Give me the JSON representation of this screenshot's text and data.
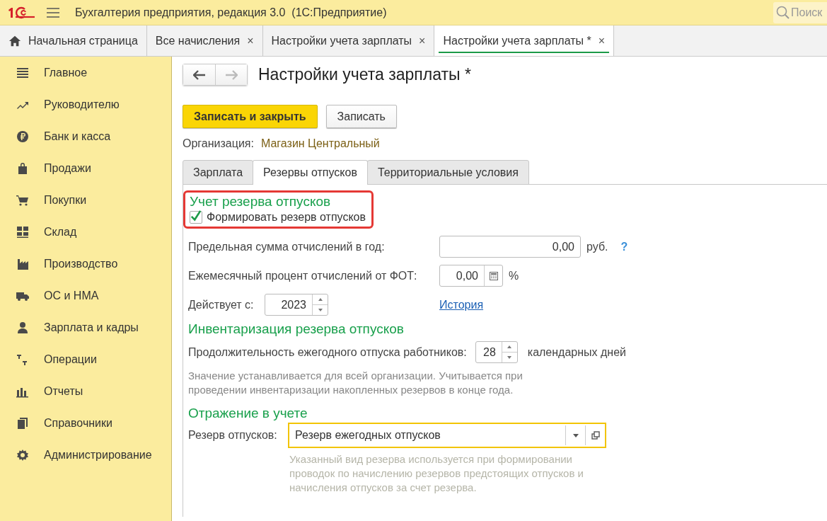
{
  "app_bar": {
    "title": "Бухгалтерия предприятия, редакция 3.0  (1С:Предприятие)",
    "search": {
      "placeholder": "Поиск"
    }
  },
  "open_tabs": [
    {
      "label": "Начальная страница",
      "selected": false,
      "kind": "home"
    },
    {
      "label": "Все начисления",
      "selected": false,
      "kind": "closable",
      "close": "×"
    },
    {
      "label": "Настройки учета зарплаты",
      "selected": false,
      "kind": "closable",
      "close": "×"
    },
    {
      "label": "Настройки учета зарплаты *",
      "selected": true,
      "kind": "closable",
      "close": "×"
    }
  ],
  "sidebar": {
    "items": [
      {
        "label": "Главное"
      },
      {
        "label": "Руководителю"
      },
      {
        "label": "Банк и касса"
      },
      {
        "label": "Продажи"
      },
      {
        "label": "Покупки"
      },
      {
        "label": "Склад"
      },
      {
        "label": "Производство"
      },
      {
        "label": "ОС и НМА"
      },
      {
        "label": "Зарплата и кадры"
      },
      {
        "label": "Операции"
      },
      {
        "label": "Отчеты"
      },
      {
        "label": "Справочники"
      },
      {
        "label": "Администрирование"
      }
    ]
  },
  "form": {
    "title": "Настройки учета зарплаты *",
    "buttons": [
      {
        "label": "Записать и закрыть",
        "kind": "primary"
      },
      {
        "label": "Записать",
        "kind": "default"
      }
    ],
    "organization": {
      "label": "Организация:",
      "value": "Магазин Центральный"
    },
    "tabs": [
      {
        "label": "Зарплата",
        "selected": false
      },
      {
        "label": "Резервы отпусков",
        "selected": true
      },
      {
        "label": "Территориальные условия",
        "selected": false
      }
    ],
    "reserve_accounting": {
      "heading": "Учет резерва отпусков",
      "highlighted": true,
      "checkbox": {
        "label": "Формировать резерв отпусков",
        "checked": true
      }
    },
    "limit": {
      "label": "Предельная сумма отчислений в год:",
      "value": "0,00",
      "unit": "руб.",
      "help": "?"
    },
    "monthly_percent": {
      "label": "Ежемесячный процент отчислений от ФОТ:",
      "value": "0,00",
      "unit": "%"
    },
    "effective_from": {
      "label": "Действует с:",
      "value": "2023",
      "link": "История"
    },
    "inventory": {
      "heading": "Инвентаризация резерва отпусков",
      "duration": {
        "label": "Продолжительность ежегодного отпуска работников:",
        "value": "28",
        "unit": "календарных дней"
      },
      "note": "Значение устанавливается для всей организации. Учитывается при проведении инвентаризации накопленных резервов в конце года."
    },
    "posting": {
      "heading": "Отражение в учете",
      "reserve": {
        "label": "Резерв отпусков:",
        "value": "Резерв ежегодных отпусков"
      },
      "note": "Указанный вид резерва используется при формировании проводок по начислению резервов предстоящих отпусков и начисления отпусков за счет резерва."
    }
  }
}
